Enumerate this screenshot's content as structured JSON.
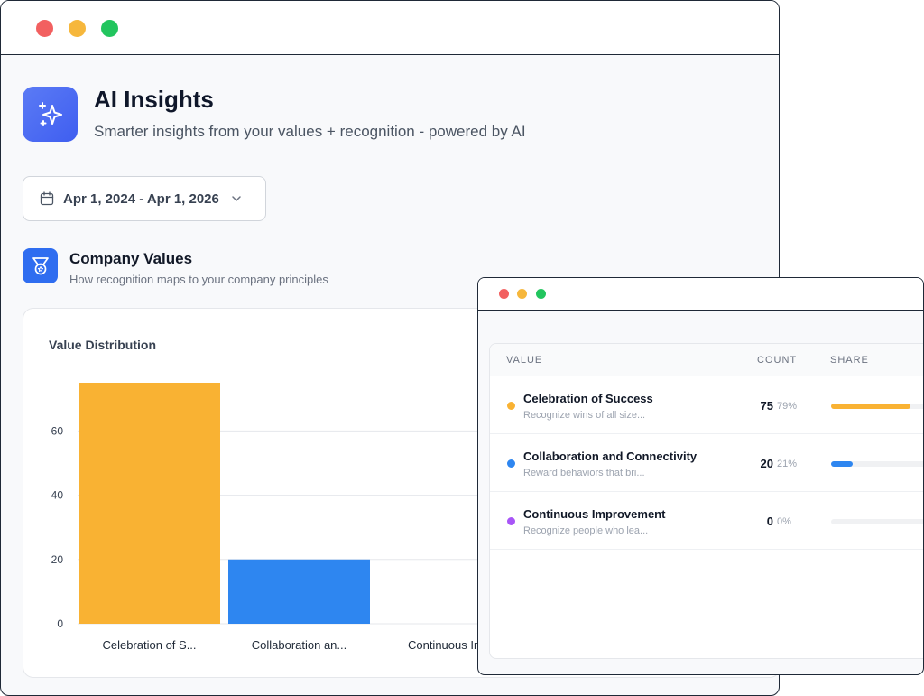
{
  "header": {
    "title": "AI Insights",
    "subtitle": "Smarter insights from your values + recognition - powered by AI"
  },
  "date_range": {
    "label": "Apr 1, 2024 - Apr 1, 2026"
  },
  "section": {
    "title": "Company Values",
    "subtitle": "How recognition maps to your company principles"
  },
  "chart_data": {
    "type": "bar",
    "title": "Value Distribution",
    "categories": [
      "Celebration of S...",
      "Collaboration an...",
      "Continuous Imp"
    ],
    "values": [
      75,
      20,
      0
    ],
    "colors": [
      "#f9b233",
      "#2e86f0",
      "#a855f7"
    ],
    "yticks": [
      0,
      20,
      40,
      60
    ],
    "ylim": [
      0,
      75
    ],
    "grid": true
  },
  "table": {
    "columns": [
      "VALUE",
      "COUNT",
      "SHARE"
    ],
    "rows": [
      {
        "name": "Celebration of Success",
        "desc": "Recognize wins of all size...",
        "count": "75",
        "pct": "79%",
        "share": 0.79,
        "color": "#f9b233"
      },
      {
        "name": "Collaboration and Connectivity",
        "desc": "Reward behaviors that bri...",
        "count": "20",
        "pct": "21%",
        "share": 0.21,
        "color": "#2e86f0"
      },
      {
        "name": "Continuous Improvement",
        "desc": "Recognize people who lea...",
        "count": "0",
        "pct": "0%",
        "share": 0,
        "color": "#a855f7"
      }
    ]
  },
  "icons": {
    "app": "sparkles-icon",
    "section": "medal-icon",
    "date": "calendar-icon",
    "dropdown": "chevron-down-icon"
  }
}
